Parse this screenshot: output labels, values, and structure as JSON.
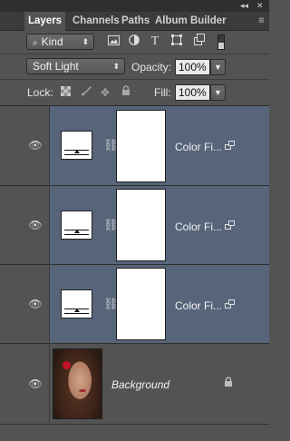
{
  "window": {
    "minimize": "◂◂",
    "close": "✕"
  },
  "tabs": [
    {
      "label": "Layers",
      "active": true
    },
    {
      "label": "Channels",
      "active": false
    },
    {
      "label": "Paths",
      "active": false
    },
    {
      "label": "Album Builder",
      "active": false
    }
  ],
  "filter": {
    "kind_label": "Kind",
    "icons": [
      "image-filter-icon",
      "adjustment-filter-icon",
      "type-filter-icon",
      "shape-filter-icon",
      "smart-object-filter-icon",
      "filter-toggle-switch"
    ]
  },
  "blend": {
    "mode": "Soft Light",
    "opacity_label": "Opacity:",
    "opacity_value": "100%"
  },
  "lock": {
    "label": "Lock:",
    "icons": [
      "lock-transparent-icon",
      "lock-image-icon",
      "lock-position-icon",
      "lock-all-icon"
    ],
    "fill_label": "Fill:",
    "fill_value": "100%"
  },
  "layers": [
    {
      "name": "Color Fi...",
      "type": "color-fill",
      "selected": true
    },
    {
      "name": "Color Fi...",
      "type": "color-fill",
      "selected": true
    },
    {
      "name": "Color Fi...",
      "type": "color-fill",
      "selected": true
    },
    {
      "name": "Background",
      "type": "background",
      "selected": false
    }
  ],
  "colors": {
    "panel": "#535353",
    "selected": "#56657a",
    "tabbar": "#3b3b3b"
  }
}
